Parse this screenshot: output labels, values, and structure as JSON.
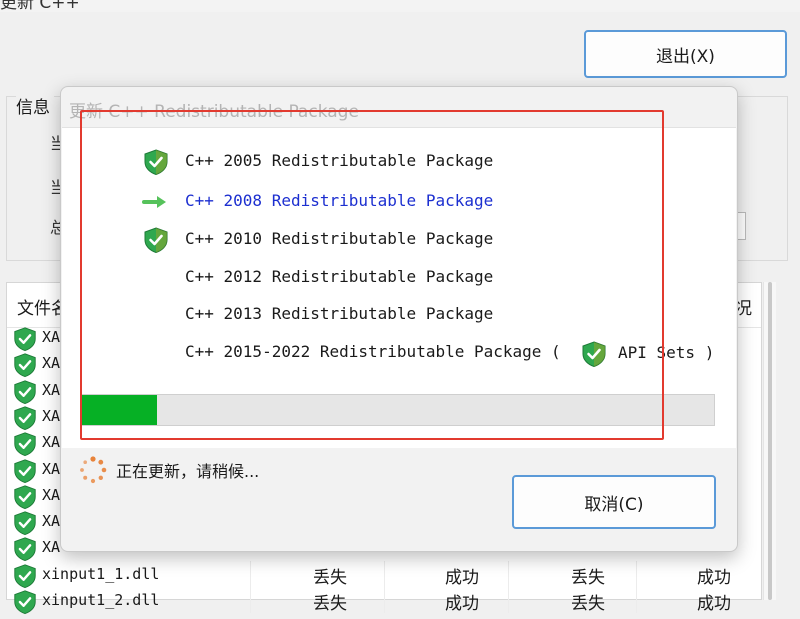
{
  "main_window": {
    "title": "更新 C++",
    "exit_label": "退出(X)",
    "info_label": "信息",
    "info_stub_1": "当",
    "info_stub_2": "当",
    "info_stub_3": "总",
    "file_list_header_name": "文件名",
    "file_list_header_last": "况",
    "file_rows": [
      {
        "name": "XA"
      },
      {
        "name": "XA"
      },
      {
        "name": "XA"
      },
      {
        "name": "XA"
      },
      {
        "name": "XA"
      },
      {
        "name": "XA"
      },
      {
        "name": "XA"
      },
      {
        "name": "XA"
      },
      {
        "name": "XA"
      },
      {
        "name": "xinput1_1.dll",
        "c1": "丢失",
        "c2": "成功",
        "c3": "丢失",
        "c4": "成功"
      },
      {
        "name": "xinput1_2.dll",
        "c1": "丢失",
        "c2": "成功",
        "c3": "丢失",
        "c4": "成功"
      }
    ]
  },
  "dialog": {
    "title": "更新 C++ Redistributable Package",
    "packages": [
      {
        "label": "C++ 2005 Redistributable Package",
        "status": "done",
        "icon": "shield-check-icon"
      },
      {
        "label": "C++ 2008 Redistributable Package",
        "status": "current",
        "icon": "arrow-right-icon"
      },
      {
        "label": "C++ 2010 Redistributable Package",
        "status": "done",
        "icon": "shield-check-icon"
      },
      {
        "label": "C++ 2012 Redistributable Package",
        "status": "pending",
        "icon": ""
      },
      {
        "label": "C++ 2013 Redistributable Package",
        "status": "pending",
        "icon": ""
      },
      {
        "label": "C++ 2015-2022 Redistributable Package (",
        "status": "pending",
        "icon": ""
      }
    ],
    "api_sets_label": "API Sets )",
    "progress_fraction": 0.12,
    "status_text": "正在更新，请稍候...",
    "cancel_label": "取消(C)"
  },
  "colors": {
    "progress_fill": "#06b025",
    "highlight_border": "#e23a2f",
    "current_item_text": "#1c2fd0",
    "shield_green": "#2fa84f",
    "spinner_orange": "#e8833a"
  }
}
